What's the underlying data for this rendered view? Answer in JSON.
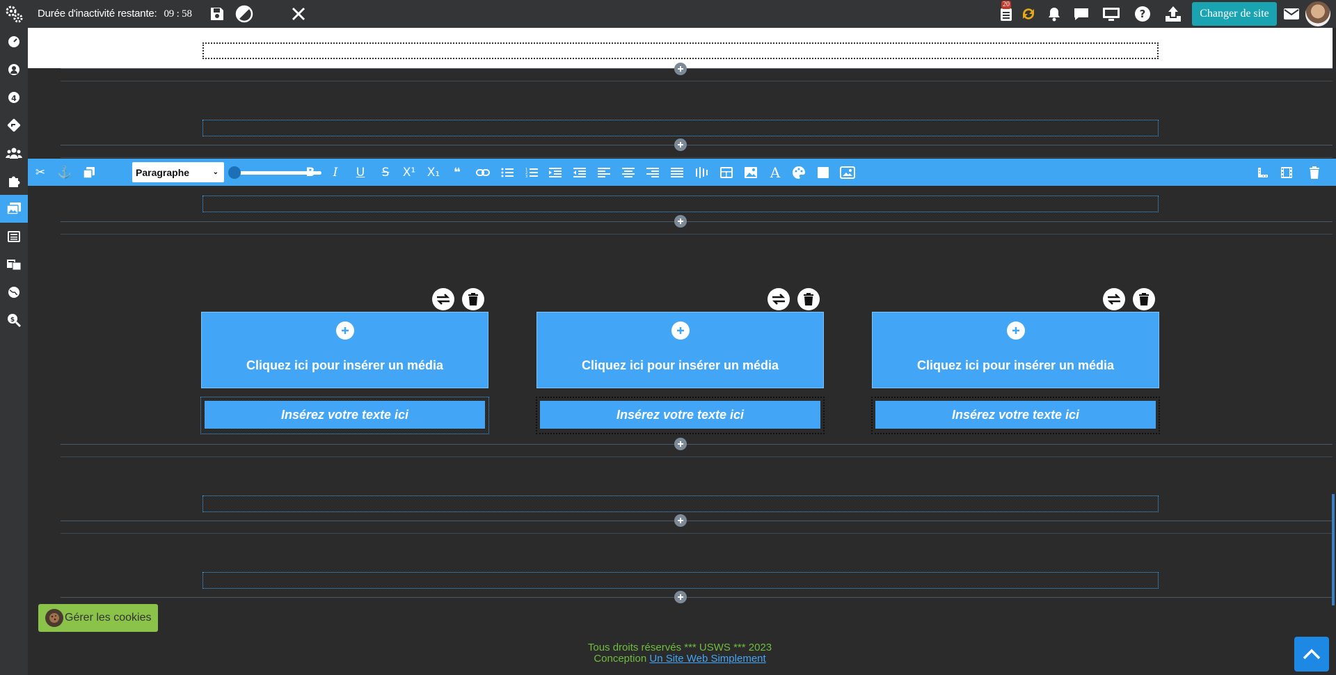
{
  "topbar": {
    "inactivity_label": "Durée d'inactivité restante:",
    "inactivity_time": "09 : 58",
    "notification_count": "20",
    "change_site_label": "Changer de site"
  },
  "toolbar": {
    "paragraph_select": "Paragraphe"
  },
  "columns": [
    {
      "media_label": "Cliquez ici pour insérer un média",
      "text_label": "Insérez votre texte ici"
    },
    {
      "media_label": "Cliquez ici pour insérer un média",
      "text_label": "Insérez votre texte ici"
    },
    {
      "media_label": "Cliquez ici pour insérer un média",
      "text_label": "Insérez votre texte ici"
    }
  ],
  "cookies_button": "Gérer les cookies",
  "footer": {
    "rights": "Tous droits réservés *** USWS *** 2023",
    "conception_label": "Conception",
    "conception_link": "Un Site Web Simplement"
  },
  "colors": {
    "accent": "#3ea6f2",
    "topbar_bg": "#333537",
    "canvas_bg": "#2b2b2b",
    "change_site_bg": "#1aa3b1",
    "cookies_bg": "#8bc34a",
    "footer_text": "#6ebd3f"
  }
}
